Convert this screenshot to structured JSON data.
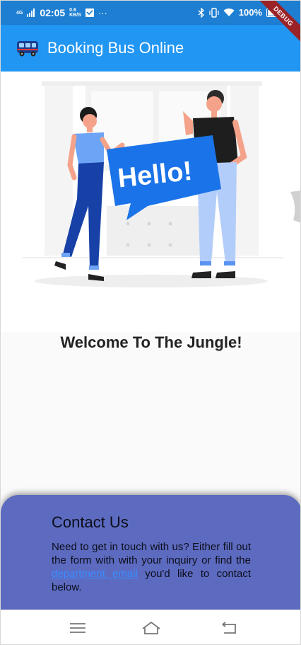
{
  "status_bar": {
    "network": "4G",
    "time": "02:05",
    "speed_value": "0.6",
    "speed_unit": "KB/S",
    "more": "···",
    "battery_text": "100%",
    "battery_level": 1.0
  },
  "debug_banner": "DEBUG",
  "app_bar": {
    "title": "Booking Bus Online",
    "icon": "bus-icon"
  },
  "hero": {
    "sign_text": "Hello!"
  },
  "welcome": "Welcome To The Jungle!",
  "contact": {
    "title": "Contact Us",
    "text_before": "Need to get in touch with us? Either fill out the form with with your inquiry or find the ",
    "link_text": "department email",
    "text_after": " you'd like to contact below."
  },
  "nav": {
    "menu_icon": "menu-icon",
    "home_icon": "home-icon",
    "back_icon": "back-icon"
  },
  "colors": {
    "status_bar": "#1e7fd2",
    "app_bar": "#2196f3",
    "contact_card": "#5c6bc0",
    "link": "#3b8cff",
    "sign": "#1a73e8"
  }
}
